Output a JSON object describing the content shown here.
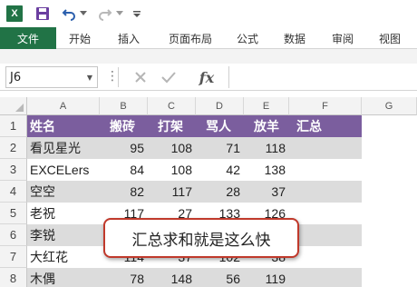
{
  "app": {
    "logo_text": "X",
    "quick_access": {
      "save_icon": "save-icon",
      "undo_icon": "undo-icon",
      "redo_icon": "redo-icon"
    }
  },
  "ribbon": {
    "tabs": [
      {
        "label": "文件",
        "active": true
      },
      {
        "label": "开始"
      },
      {
        "label": "插入"
      },
      {
        "label": "页面布局"
      },
      {
        "label": "公式"
      },
      {
        "label": "数据"
      },
      {
        "label": "审阅"
      },
      {
        "label": "视图"
      }
    ],
    "file_tab_color": "#217346"
  },
  "formula_bar": {
    "name_box": "J6",
    "fx_label": "fx",
    "value": ""
  },
  "grid": {
    "columns": [
      "A",
      "B",
      "C",
      "D",
      "E",
      "F",
      "G"
    ],
    "row_numbers": [
      "1",
      "2",
      "3",
      "4",
      "5",
      "6",
      "7",
      "8"
    ],
    "header_row": [
      "姓名",
      "搬砖",
      "打架",
      "骂人",
      "放羊",
      "汇总"
    ],
    "rows": [
      [
        "看见星光",
        "95",
        "108",
        "71",
        "118",
        ""
      ],
      [
        "EXCELers",
        "84",
        "108",
        "42",
        "138",
        ""
      ],
      [
        "空空",
        "82",
        "117",
        "28",
        "37",
        ""
      ],
      [
        "老祝",
        "117",
        "27",
        "133",
        "126",
        ""
      ],
      [
        "李锐",
        "",
        "",
        "",
        "",
        ""
      ],
      [
        "大红花",
        "114",
        "37",
        "102",
        "38",
        ""
      ],
      [
        "木偶",
        "78",
        "148",
        "56",
        "119",
        ""
      ]
    ],
    "header_color": "#7b5e9e",
    "band_color": "#dcdcdc"
  },
  "callout": {
    "text": "汇总求和就是这么快",
    "border_color": "#c0392b"
  }
}
